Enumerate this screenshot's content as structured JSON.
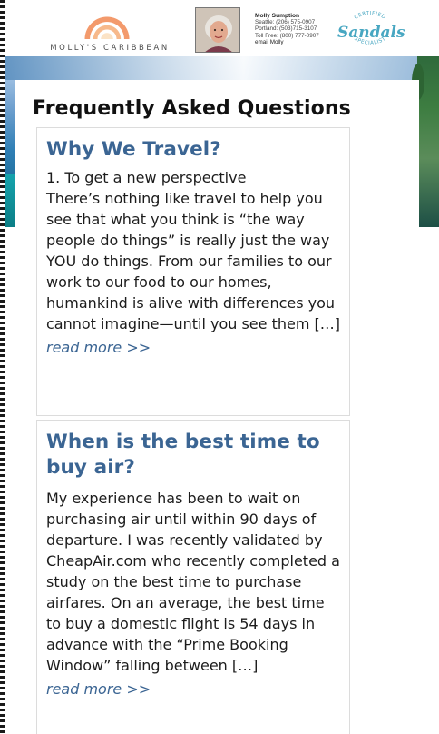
{
  "header": {
    "logo_text": "MOLLY'S CARIBBEAN",
    "contact": {
      "name": "Molly Sumption",
      "seattle": "Seattle: (206) 575-0907",
      "portland": "Portland: (503)715-3107",
      "toll_free": "Toll Free: (800) 777-0907",
      "email_label": "email Molly"
    },
    "badge": {
      "brand": "Sandals",
      "top_text": "CERTIFIED",
      "bottom_text": "SPECIALIST"
    }
  },
  "page": {
    "title": "Frequently Asked Questions"
  },
  "faq": [
    {
      "title": "Why We Travel?",
      "body": "1. To get a new perspective\nThere’s nothing like travel to help you see that what you think is “the way people do things” is really just the way YOU do things. From our families to our work to our food to our homes, humankind is alive with differences you cannot imagine—until you see them […]",
      "read_more": "read more >>"
    },
    {
      "title": "When is the best time to buy air?",
      "body": "My experience has been to wait on purchasing air until within 90 days of departure.   I was recently validated by CheapAir.com who recently completed a study on the best time to purchase airfares.  On an average, the best time to buy a domestic flight is 54 days in advance with the “Prime Booking Window” falling between […]",
      "read_more": "read more >>"
    }
  ],
  "colors": {
    "link": "#3b6593",
    "badge": "#48a7c2",
    "logo_sun": "#f39a6c"
  }
}
